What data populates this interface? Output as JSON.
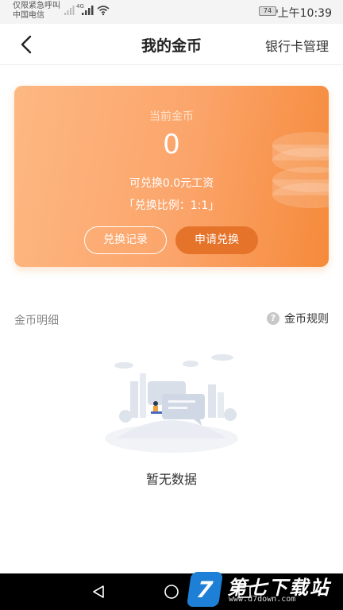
{
  "status_bar": {
    "carrier_line1": "仅限紧急呼叫",
    "carrier_line2": "中国电信",
    "network": "4G",
    "battery": "74",
    "time": "上午10:39"
  },
  "header": {
    "title": "我的金币",
    "right_link": "银行卡管理",
    "back_icon": "chevron-left-icon"
  },
  "coin_card": {
    "label": "当前金币",
    "value": "0",
    "exchange_text": "可兑换0.0元工资",
    "ratio_text": "「兑换比例：1:1」",
    "records_button": "兑换记录",
    "apply_button": "申请兑换",
    "colors": {
      "gradient_start": "#fdb882",
      "gradient_end": "#f58a3a",
      "apply_button": "#e5732a"
    }
  },
  "details": {
    "title": "金币明细",
    "rules_link": "金币规则",
    "rules_icon": "question-circle-icon"
  },
  "empty_state": {
    "text": "暂无数据"
  },
  "watermark": {
    "badge": "7",
    "title": "第七下载站",
    "url": "www.d7down.com"
  }
}
